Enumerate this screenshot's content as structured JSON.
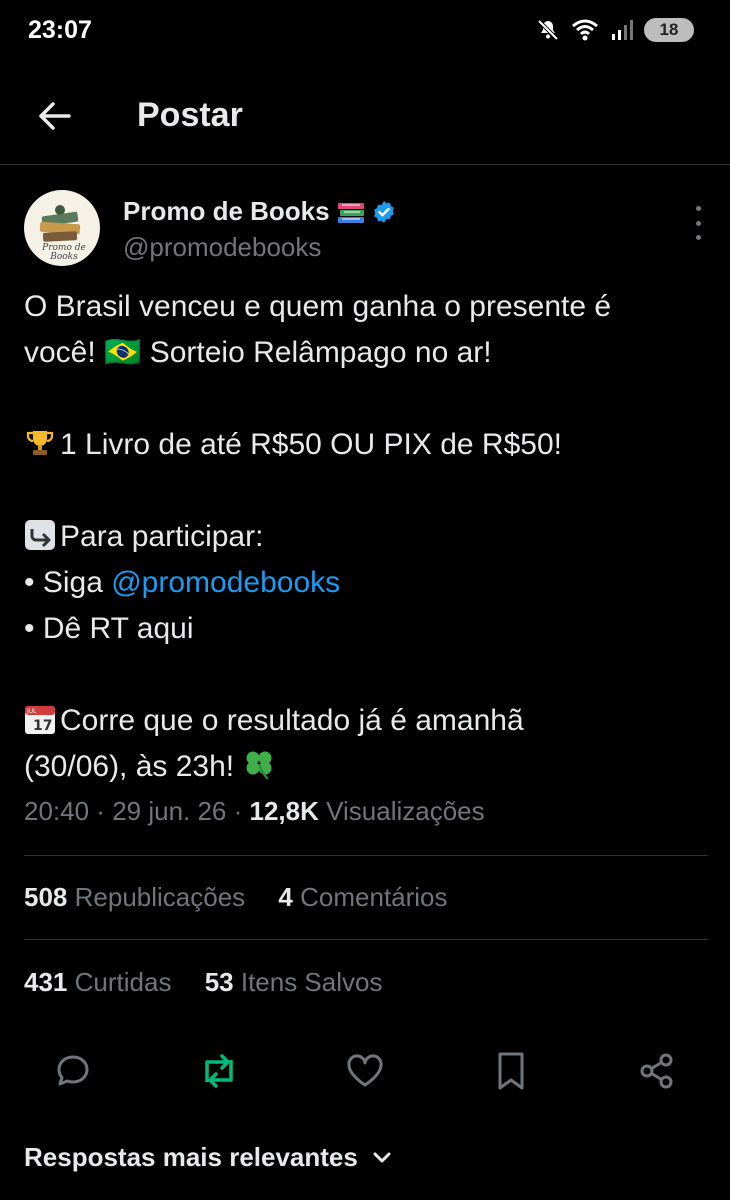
{
  "status_bar": {
    "time": "23:07",
    "battery": "18"
  },
  "header": {
    "title": "Postar"
  },
  "author": {
    "display_name": "Promo de Books",
    "handle": "@promodebooks",
    "avatar_text": "Promo de Books"
  },
  "tweet": {
    "line1": "O Brasil venceu e quem ganha o presente é",
    "line2": "você! 🇧🇷 Sorteio Relâmpago no ar!",
    "prize": "1 Livro de até R$50 OU PIX de R$50!",
    "participate": "Para participar:",
    "step1_prefix": "• Siga ",
    "step1_mention": "@promodebooks",
    "step2": "• Dê RT aqui",
    "result_line1": "Corre que o resultado já é amanhã",
    "result_line2": "(30/06), às 23h!",
    "calendar_month": "JUL",
    "calendar_day": "17"
  },
  "meta": {
    "time": "20:40",
    "date": "29 jun. 26",
    "views_count": "12,8K",
    "views_label": "Visualizações"
  },
  "stats": {
    "reposts_count": "508",
    "reposts_label": "Republicações",
    "comments_count": "4",
    "comments_label": "Comentários",
    "likes_count": "431",
    "likes_label": "Curtidas",
    "saved_count": "53",
    "saved_label": "Itens Salvos"
  },
  "replies_sort": {
    "label": "Respostas mais relevantes"
  },
  "colors": {
    "accent": "#1d9bf0",
    "repost_active": "#00ba7c",
    "muted": "#71767b",
    "background": "#000000"
  },
  "icons": [
    "mute-icon",
    "wifi-icon",
    "signal-icon",
    "battery-icon",
    "back-arrow-icon",
    "verified-badge-icon",
    "books-emoji-icon",
    "more-icon",
    "trophy-emoji-icon",
    "arrow-emoji-icon",
    "calendar-emoji-icon",
    "clover-emoji-icon",
    "reply-icon",
    "repost-icon",
    "like-icon",
    "bookmark-icon",
    "share-icon",
    "chevron-down-icon"
  ]
}
